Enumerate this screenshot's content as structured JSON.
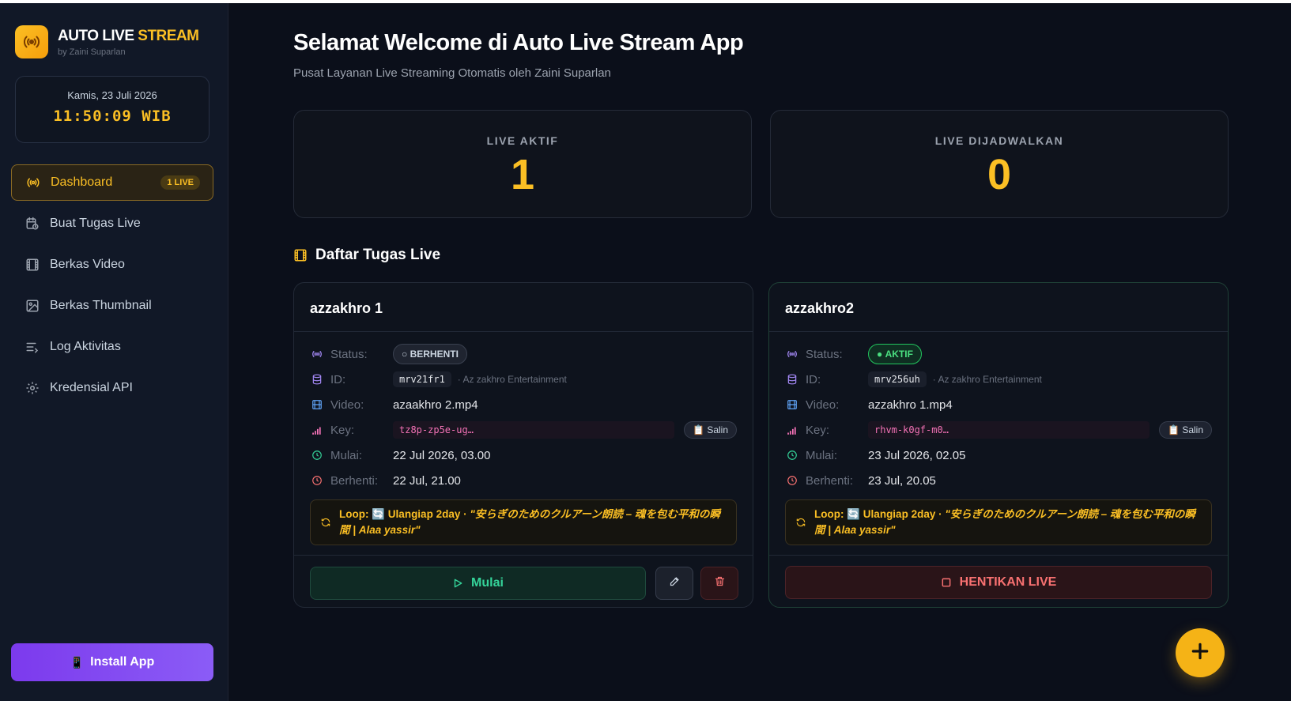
{
  "brand": {
    "title_main": "AUTO LIVE",
    "title_accent": "STREAM",
    "subtitle": "by Zaini Suparlan"
  },
  "clock": {
    "date": "Kamis, 23 Juli 2026",
    "time": "11:50:09 WIB"
  },
  "nav": [
    {
      "label": "Dashboard",
      "icon": "broadcast-icon",
      "badge": "1 LIVE",
      "active": true
    },
    {
      "label": "Buat Tugas Live",
      "icon": "calendar-clock-icon"
    },
    {
      "label": "Berkas Video",
      "icon": "film-icon"
    },
    {
      "label": "Berkas Thumbnail",
      "icon": "image-icon"
    },
    {
      "label": "Log Aktivitas",
      "icon": "list-icon"
    },
    {
      "label": "Kredensial API",
      "icon": "gear-icon"
    }
  ],
  "install": {
    "label": "Install App"
  },
  "header": {
    "title": "Selamat Welcome di Auto Live Stream App",
    "subtitle": "Pusat Layanan Live Streaming Otomatis oleh Zaini Suparlan"
  },
  "stats": {
    "live_active": {
      "label": "LIVE AKTIF",
      "value": "1"
    },
    "live_scheduled": {
      "label": "LIVE DIJADWALKAN",
      "value": "0"
    }
  },
  "section": {
    "title": "Daftar Tugas Live"
  },
  "labels": {
    "status": "Status:",
    "id": "ID:",
    "video": "Video:",
    "key": "Key:",
    "start": "Mulai:",
    "stop": "Berhenti:",
    "copy": "Salin",
    "loop": "Loop:"
  },
  "tasks": [
    {
      "name": "azzakhro 1",
      "status": "BERHENTI",
      "id": "mrv21fr1",
      "channel": "· Az zakhro Entertainment",
      "video": "azaakhro 2.mp4",
      "key": "tz8p-zp5e-ug…",
      "start": "22 Jul 2026, 03.00",
      "stop": "22 Jul, 21.00",
      "loop_repeat": "🔄 Ulangiap 2day",
      "loop_title": "\"安らぎのためのクルアーン朗読 – 魂を包む平和の瞬間 | Alaa yassir\"",
      "action": "Mulai"
    },
    {
      "name": "azzakhro2",
      "status": "AKTIF",
      "id": "mrv256uh",
      "channel": "· Az zakhro Entertainment",
      "video": "azzakhro 1.mp4",
      "key": "rhvm-k0gf-m0…",
      "start": "23 Jul 2026, 02.05",
      "stop": "23 Jul, 20.05",
      "loop_repeat": "🔄 Ulangiap 2day",
      "loop_title": "\"安らぎのためのクルアーン朗読 – 魂を包む平和の瞬間 | Alaa yassir\"",
      "action": "HENTIKAN LIVE"
    }
  ],
  "colors": {
    "accent": "#fbbf24",
    "success": "#34d399",
    "danger": "#f87171",
    "purple": "#7c3aed"
  }
}
